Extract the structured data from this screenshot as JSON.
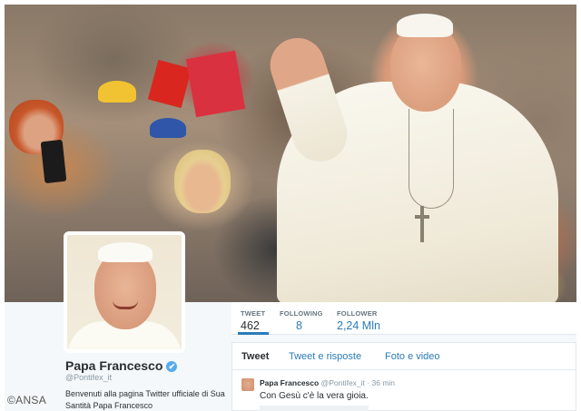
{
  "watermark": "©ANSA",
  "stats": [
    {
      "label": "TWEET",
      "value": "462"
    },
    {
      "label": "FOLLOWING",
      "value": "8"
    },
    {
      "label": "FOLLOWER",
      "value": "2,24 Mln"
    }
  ],
  "profile": {
    "name": "Papa Francesco",
    "handle": "@Pontifex_it",
    "bio": "Benvenuti alla pagina Twitter ufficiale di Sua Santità Papa Francesco",
    "verified_icon": "✔"
  },
  "tabs": [
    "Tweet",
    "Tweet e risposte",
    "Foto e video"
  ],
  "tweet": {
    "author": "Papa Francesco",
    "handle": "@Pontifex_it",
    "separator": "·",
    "time": "36 min",
    "text": "Con Gesù c'è la vera gioia."
  },
  "colors": {
    "link": "#2b7bb9",
    "verified": "#55acee",
    "text": "#292f33",
    "muted": "#8899a6"
  }
}
